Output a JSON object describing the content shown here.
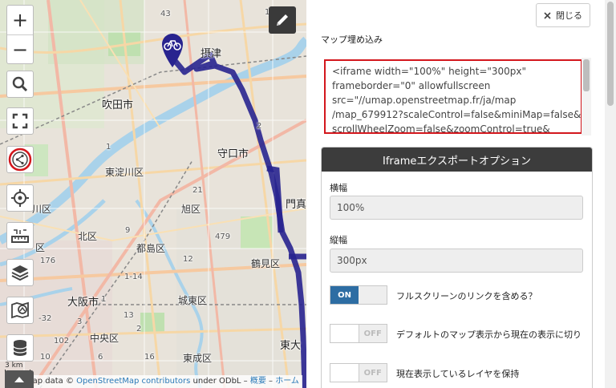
{
  "map": {
    "labels": {
      "settsu": "摂津",
      "suita": "吹田市",
      "moriguchi": "守口市",
      "higashiyodogawa": "東淀川区",
      "kado": "門真",
      "ku1": "川区",
      "asahi": "旭区",
      "hoku": "北区",
      "ku2": "区",
      "miyakojima": "都島区",
      "tsurumi": "鶴見区",
      "osaka": "大阪市",
      "joto": "城東区",
      "chuo": "中央区",
      "higashinari": "東成区",
      "higashiosaka": "東大",
      "r43": "43",
      "r14": "14",
      "r1": "1",
      "r2": "2",
      "r21": "21",
      "r176": "176",
      "r479": "479",
      "r9": "9",
      "r14b": "1-14",
      "r12": "12",
      "r13": "13",
      "r6": "6",
      "r3": "3",
      "r16": "16",
      "r2b": "2",
      "r1b": "1",
      "r102": "102",
      "r10": "10",
      "rr": "-32"
    },
    "controls": {
      "zoom_in": "+",
      "zoom_out": "−"
    },
    "scale_text": "3 km",
    "attribution": {
      "prefix": "Map data © ",
      "osm": "OpenStreetMap contributors",
      "mid": " under ODbL – ",
      "about": "概要",
      "sep": " – ",
      "home": "ホーム"
    },
    "colors": {
      "route": "#28238f",
      "marker": "#28238f",
      "share_ring": "#d3171d"
    }
  },
  "panel": {
    "close_label": "閉じる",
    "embed_title": "マップ埋め込み",
    "embed_code_lines": [
      "<iframe width=\"100%\" height=\"300px\"",
      "frameborder=\"0\" allowfullscreen",
      "src=\"//umap.openstreetmap.fr/ja/map",
      "/map_679912?scaleControl=false&miniMap=false&",
      "scrollWheelZoom=false&zoomControl=true&"
    ],
    "options": {
      "header": "Iframeエクスポートオプション",
      "width_label": "横幅",
      "width_value": "100%",
      "height_label": "縦幅",
      "height_value": "300px",
      "toggle_on": "ON",
      "toggle_off": "OFF",
      "toggles": [
        {
          "label": "フルスクリーンのリンクを含める？",
          "state": "ON"
        },
        {
          "label": "デフォルトのマップ表示から現在の表示に切り",
          "state": "OFF"
        },
        {
          "label": "現在表示しているレイヤを保持",
          "state": "OFF"
        }
      ]
    }
  }
}
